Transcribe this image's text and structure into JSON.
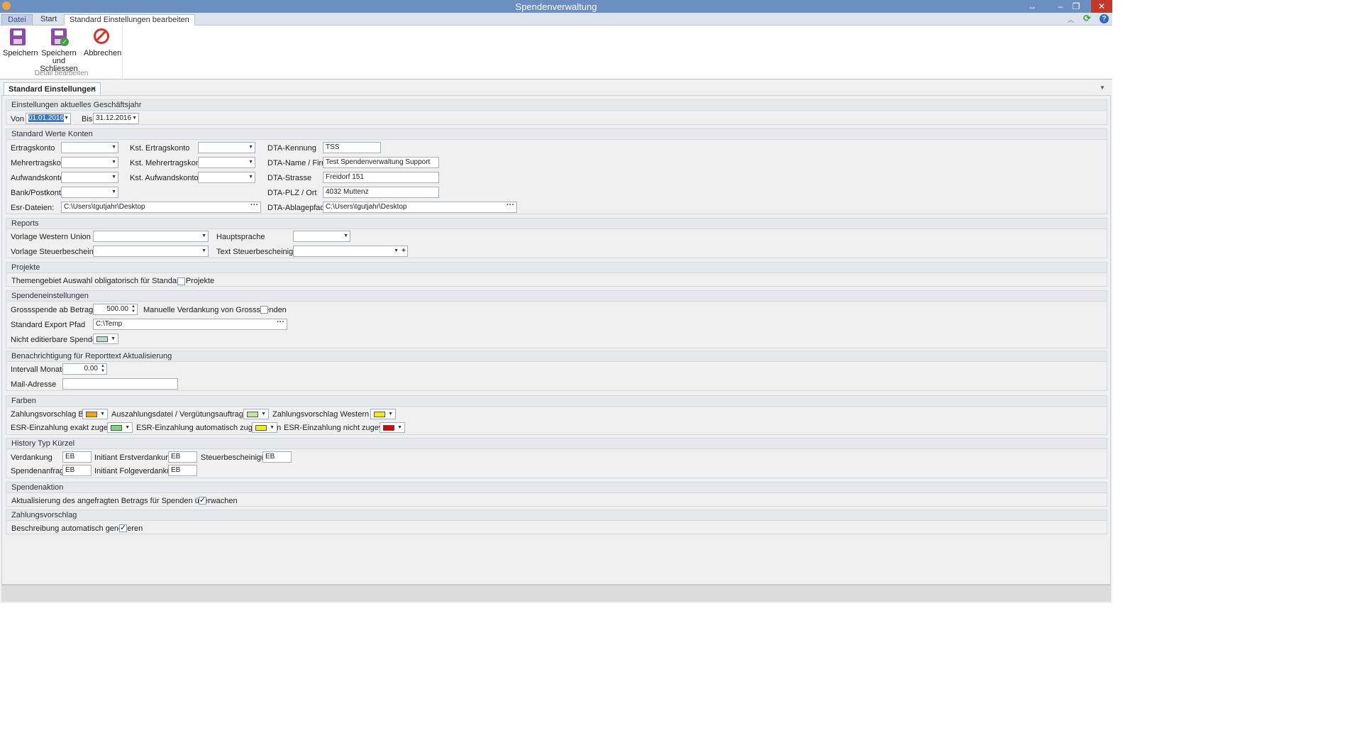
{
  "window": {
    "title": "Spendenverwaltung",
    "btn_restore": "↔",
    "btn_min": "–",
    "btn_max": "❐",
    "btn_close": "✕"
  },
  "ribbon": {
    "tabs": [
      "Datei",
      "Start",
      "Standard Einstellungen bearbeiten"
    ],
    "buttons": {
      "save": "Speichern",
      "save_close": "Speichern und Schliessen",
      "cancel": "Abbrechen"
    },
    "group_label": "Detail bearbeiten"
  },
  "doctab": {
    "label": "Standard Einstellungen",
    "close": "✕"
  },
  "colors": {
    "orange": "#f0a800",
    "lightgreen": "#c5e6a0",
    "yellow": "#f6f000",
    "green": "#7cd67c",
    "red": "#e00000",
    "mint": "#b8dccc"
  },
  "g1": {
    "title": "Einstellungen aktuelles Geschäftsjahr",
    "von": "Von",
    "von_val": "01.01.2016",
    "bis": "Bis",
    "bis_val": "31.12.2016"
  },
  "g2": {
    "title": "Standard Werte Konten",
    "ertragskonto": "Ertragskonto",
    "mehrertragskonto": "Mehrertragskonto",
    "aufwandskonto": "Aufwandskonto",
    "bankpostkonto": "Bank/Postkonto",
    "esr_dateien": "Esr-Dateien:",
    "esr_path": "C:\\Users\\tgutjahr\\Desktop",
    "kst_ertrag": "Kst. Ertragskonto",
    "kst_mehrertrag": "Kst. Mehrertragskonto",
    "kst_aufwand": "Kst. Aufwandskonto",
    "dta_kennung": "DTA-Kennung",
    "dta_kennung_val": "TSS",
    "dta_name": "DTA-Name / Firma",
    "dta_name_val": "Test Spendenverwaltung Support",
    "dta_strasse": "DTA-Strasse",
    "dta_strasse_val": "Freidorf 151",
    "dta_plz": "DTA-PLZ / Ort",
    "dta_plz_val": "4032 Muttenz",
    "dta_ablage": "DTA-Ablagepfad",
    "dta_ablage_val": "C:\\Users\\tgutjahr\\Desktop"
  },
  "g3": {
    "title": "Reports",
    "western_union": "Vorlage Western Union",
    "steuer": "Vorlage Steuerbescheinigung",
    "hauptsprache": "Hauptsprache",
    "text_steuer": "Text Steuerbescheinigung"
  },
  "g4": {
    "title": "Projekte",
    "themengebiet": "Themengebiet Auswahl obligatorisch für Standard Projekte"
  },
  "g5": {
    "title": "Spendeneinstellungen",
    "grossspende": "Grossspende ab Betrag CHF",
    "grossspende_val": "500.00",
    "manuelle": "Manuelle Verdankung von Grossspenden",
    "export": "Standard Export Pfad",
    "export_val": "C:\\Temp",
    "nicht_edit": "Nicht editierbare Spende"
  },
  "g6": {
    "title": "Benachrichtigung für Reporttext Aktualisierung",
    "intervall": "Intervall Monate",
    "intervall_val": "0.00",
    "mail": "Mail-Adresse"
  },
  "g7": {
    "title": "Farben",
    "zv_bar": "Zahlungsvorschlag Bar",
    "auszahlung": "Auszahlungsdatei / Vergütungsauftrag erstellt",
    "zv_wu": "Zahlungsvorschlag Western Union",
    "esr_exakt": "ESR-Einzahlung exakt zugewiesen",
    "esr_auto": "ESR-Einzahlung automatisch zugewiesen",
    "esr_nicht": "ESR-Einzahlung nicht zugewiesen"
  },
  "g8": {
    "title": "History Typ Kürzel",
    "verdankung": "Verdankung",
    "verdankung_val": "EB",
    "initiant_erst": "Initiant Erstverdankung",
    "initiant_erst_val": "EB",
    "steuer": "Steuerbescheinigung",
    "steuer_val": "EB",
    "anfrage": "Spendenanfrage",
    "anfrage_val": "EB",
    "initiant_folge": "Initiant Folgeverdankung",
    "initiant_folge_val": "EB"
  },
  "g9": {
    "title": "Spendenaktion",
    "aktualisierung": "Aktualisierung des angefragten Betrags für Spenden überwachen"
  },
  "g10": {
    "title": "Zahlungsvorschlag",
    "beschreibung": "Beschreibung automatisch generieren"
  }
}
